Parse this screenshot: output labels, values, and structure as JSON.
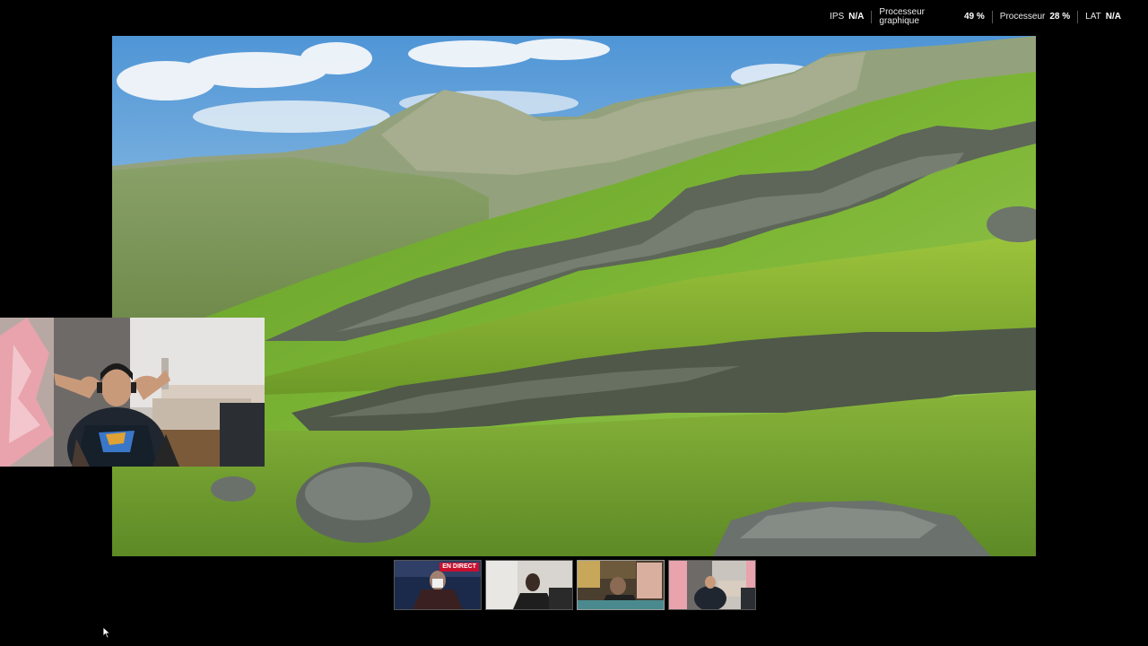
{
  "perf": {
    "ips_label": "IPS",
    "ips_value": "N/A",
    "gpu_label_line1": "Processeur",
    "gpu_label_line2": "graphique",
    "gpu_value": "49 %",
    "cpu_label": "Processeur",
    "cpu_value": "28 %",
    "lat_label": "LAT",
    "lat_value": "N/A"
  },
  "thumbnails": {
    "live_badge": "EN DIRECT"
  }
}
